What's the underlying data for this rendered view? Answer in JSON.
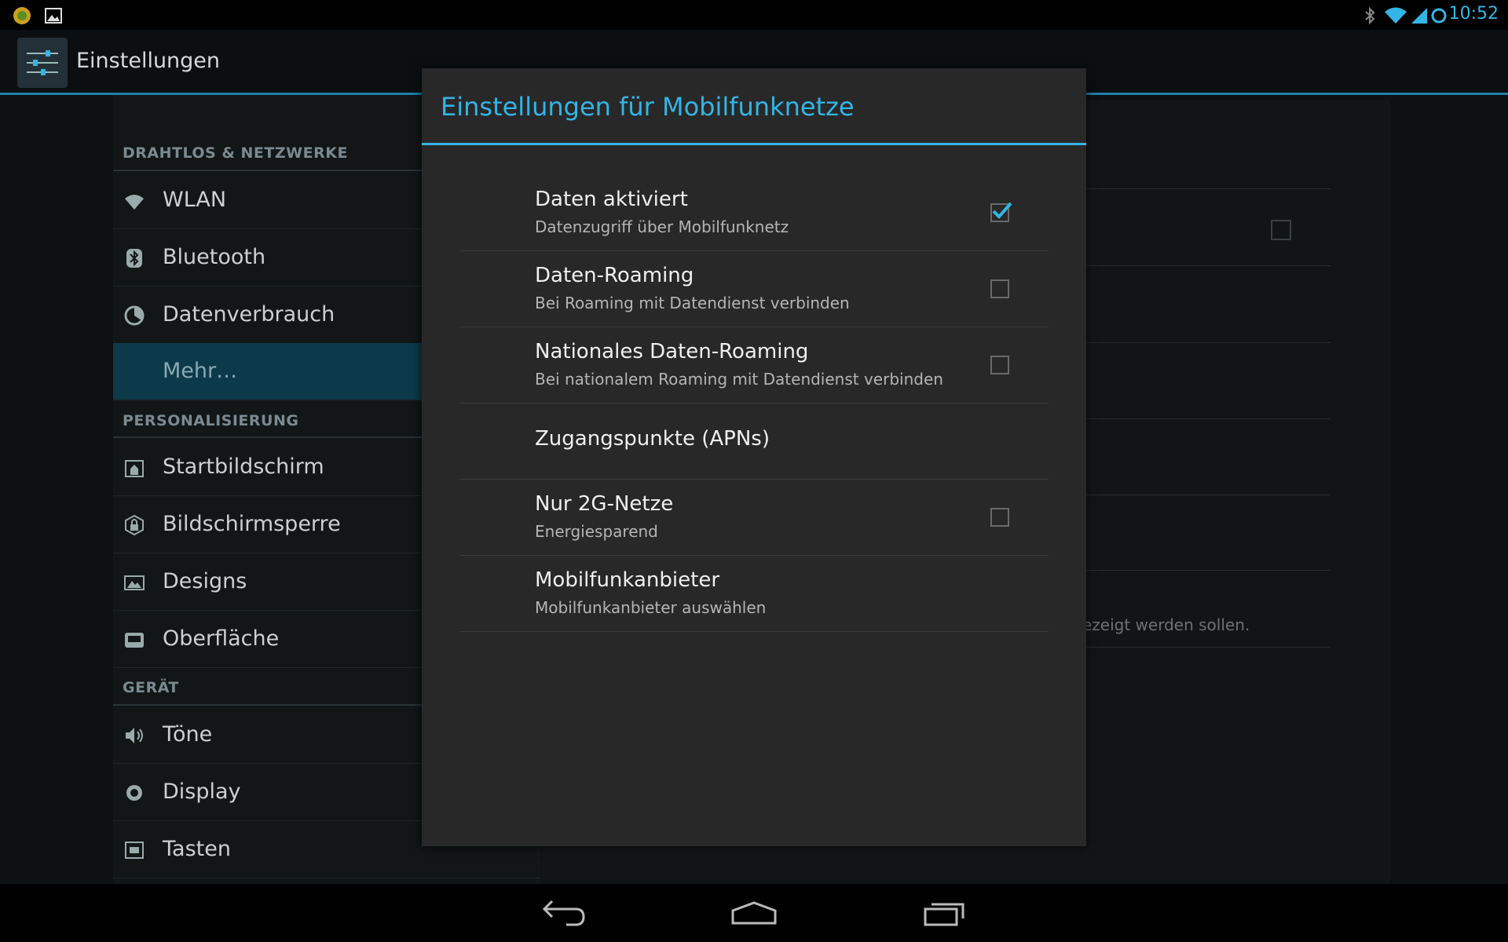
{
  "status_bar": {
    "time": "10:52",
    "accent": "#33b5e5"
  },
  "action_bar": {
    "title": "Einstellungen"
  },
  "sidebar": {
    "sections": [
      {
        "header": "DRAHTLOS & NETZWERKE"
      },
      {
        "header": "PERSONALISIERUNG"
      },
      {
        "header": "GERÄT"
      }
    ],
    "items": [
      {
        "label": "WLAN",
        "icon": "wifi-icon"
      },
      {
        "label": "Bluetooth",
        "icon": "bluetooth-icon"
      },
      {
        "label": "Datenverbrauch",
        "icon": "data-usage-icon"
      },
      {
        "label": "Mehr…",
        "icon": ""
      },
      {
        "label": "Startbildschirm",
        "icon": "home-screen-icon"
      },
      {
        "label": "Bildschirmsperre",
        "icon": "lock-icon"
      },
      {
        "label": "Designs",
        "icon": "themes-icon"
      },
      {
        "label": "Oberfläche",
        "icon": "interface-icon"
      },
      {
        "label": "Töne",
        "icon": "sound-icon"
      },
      {
        "label": "Display",
        "icon": "display-icon"
      },
      {
        "label": "Tasten",
        "icon": "keys-icon"
      }
    ]
  },
  "background": {
    "partial_text": "ezeigt werden sollen."
  },
  "dialog": {
    "title": "Einstellungen für Mobilfunknetze",
    "rows": [
      {
        "title": "Daten aktiviert",
        "summary": "Datenzugriff über Mobilfunknetz",
        "checked": true
      },
      {
        "title": "Daten-Roaming",
        "summary": "Bei Roaming mit Datendienst verbinden",
        "checked": false
      },
      {
        "title": "Nationales Daten-Roaming",
        "summary": "Bei nationalem Roaming mit Datendienst verbinden",
        "checked": false
      },
      {
        "title": "Zugangspunkte (APNs)",
        "summary": ""
      },
      {
        "title": "Nur 2G-Netze",
        "summary": "Energiesparend",
        "checked": false
      },
      {
        "title": "Mobilfunkanbieter",
        "summary": "Mobilfunkanbieter auswählen"
      }
    ]
  }
}
